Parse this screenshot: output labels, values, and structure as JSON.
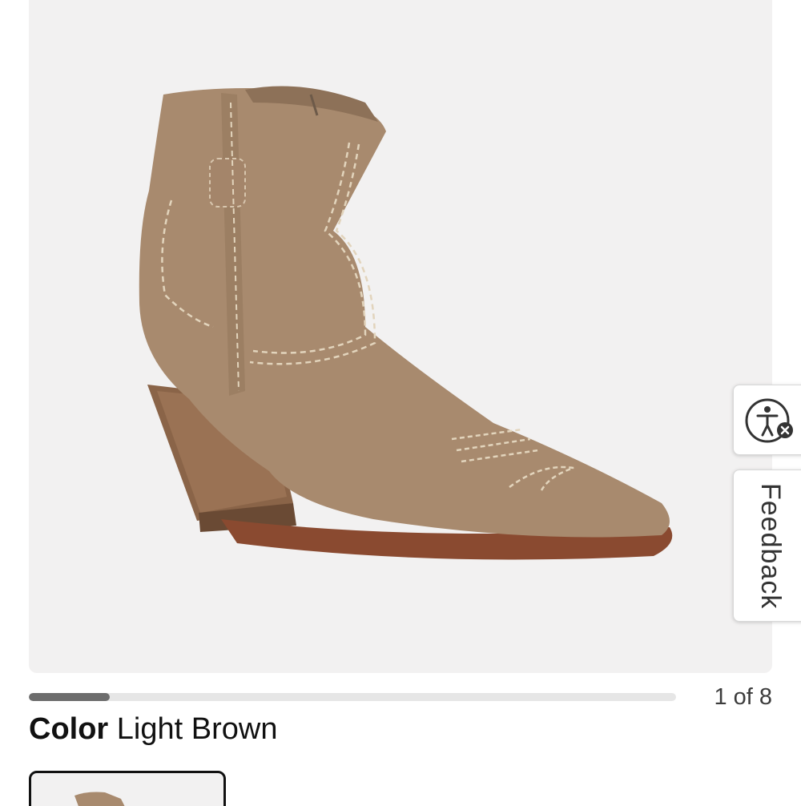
{
  "product": {
    "image_alt": "Light brown suede western ankle boot",
    "carousel": {
      "current": 1,
      "total": 8,
      "counter_text": "1 of 8",
      "progress": 0.125
    },
    "color": {
      "label": "Color",
      "value": "Light Brown"
    },
    "swatches": [
      {
        "name": "Light Brown",
        "selected": true
      }
    ]
  },
  "side_tabs": {
    "accessibility_icon": "accessibility-person-icon",
    "feedback_label": "Feedback"
  },
  "colors": {
    "image_bg": "#f2f1f1",
    "boot_suede": "#a88a6e",
    "heel_wood": "#8a6448",
    "progress_fill": "#6d6d6d"
  }
}
